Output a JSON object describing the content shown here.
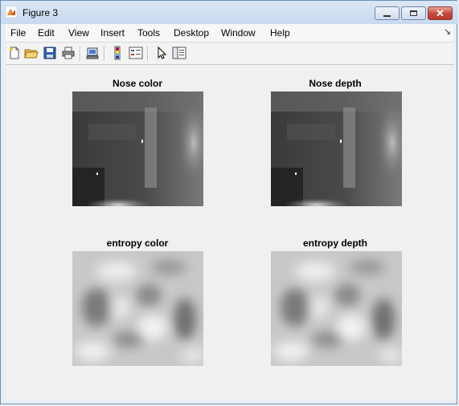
{
  "window": {
    "title": "Figure 3"
  },
  "menu": [
    "File",
    "Edit",
    "View",
    "Insert",
    "Tools",
    "Desktop",
    "Window",
    "Help"
  ],
  "toolbar": [
    "new-figure",
    "open-file",
    "save",
    "print",
    "link-print",
    "colorbar",
    "legend",
    "pointer",
    "property-editor"
  ],
  "axes": [
    {
      "title": "Nose color"
    },
    {
      "title": "Nose depth"
    },
    {
      "title": "entropy color"
    },
    {
      "title": "entropy depth"
    }
  ]
}
